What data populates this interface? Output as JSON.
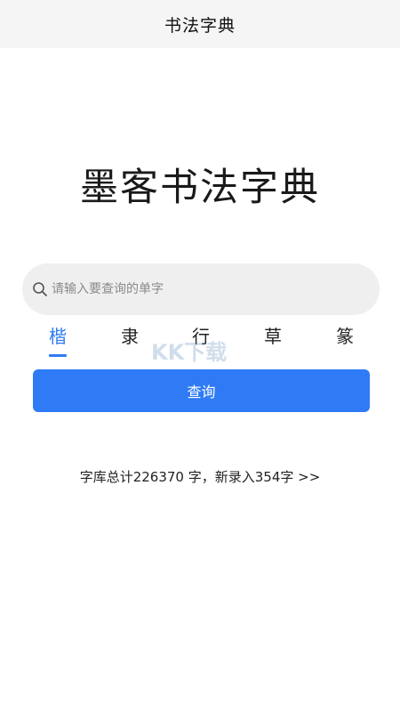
{
  "topbar": {
    "title": "书法字典"
  },
  "main": {
    "title": "墨客书法字典"
  },
  "search": {
    "placeholder": "请输入要查询的单字",
    "value": ""
  },
  "tabs": [
    {
      "label": "楷",
      "active": true
    },
    {
      "label": "隶",
      "active": false
    },
    {
      "label": "行",
      "active": false
    },
    {
      "label": "草",
      "active": false
    },
    {
      "label": "篆",
      "active": false
    }
  ],
  "watermark": {
    "text": "KK下载"
  },
  "query_button": {
    "label": "查询"
  },
  "stats": {
    "text": "字库总计226370 字，新录入354字 >>"
  },
  "colors": {
    "accent": "#2f7bf5",
    "topbar_bg": "#f5f5f5",
    "search_bg": "#efefef"
  },
  "icons": {
    "search": "search-icon"
  }
}
